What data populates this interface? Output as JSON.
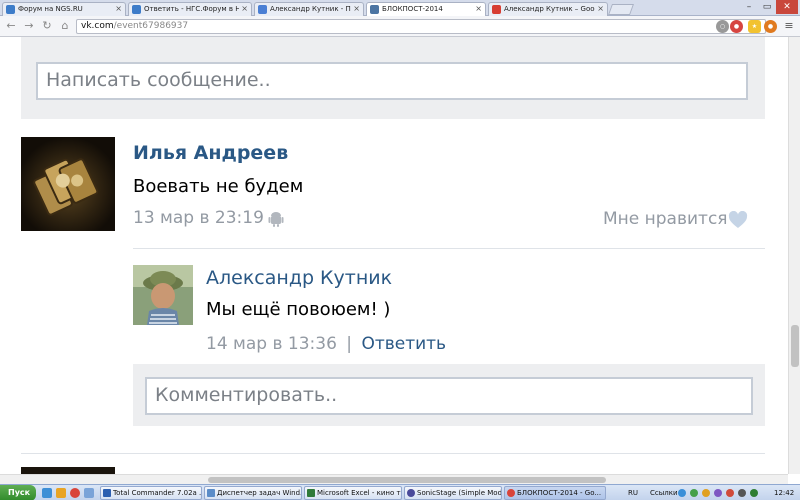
{
  "browser": {
    "tabs": [
      {
        "label": "Форум на NGS.RU",
        "active": false
      },
      {
        "label": "Ответить - НГС.Форум в Н",
        "active": false
      },
      {
        "label": "Александр Кутник - Поиск",
        "active": false
      },
      {
        "label": "БЛОКПОСТ-2014",
        "active": true
      },
      {
        "label": "Александр Кутник – Google+",
        "active": false
      }
    ],
    "address": {
      "host": "vk.com",
      "path": "/event67986937"
    },
    "window_controls": {
      "minimize": "–",
      "maximize": "▭",
      "close": "✕"
    }
  },
  "composer": {
    "placeholder": "Написать сообщение.."
  },
  "post": {
    "author": "Илья Андреев",
    "text": "Воевать не будем",
    "date": "13 мар в 23:19",
    "like_label": "Мне нравится",
    "reply": {
      "author": "Александр Кутник",
      "text": "Мы ещё повоюем! )",
      "date": "14 мар в 13:36",
      "separator": "|",
      "reply_link": "Ответить"
    },
    "comment_placeholder": "Комментировать.."
  },
  "taskbar": {
    "start_label": "Пуск",
    "tasks": [
      {
        "label": "Total Commander 7.02a ...",
        "active": false
      },
      {
        "label": "Диспетчер задач Wind...",
        "active": false
      },
      {
        "label": "Microsoft Excel - кино т...",
        "active": false
      },
      {
        "label": "SonicStage (Simple Mode)",
        "active": false
      },
      {
        "label": "БЛОКПОСТ-2014 - Go...",
        "active": true
      }
    ],
    "language": "RU",
    "links_label": "Ссылки",
    "clock": "12:42"
  },
  "colors": {
    "link_blue": "#2a5885",
    "meta_gray": "#939aa3",
    "panel_gray": "#edeef0",
    "like_heart": "#c5d4e6"
  }
}
